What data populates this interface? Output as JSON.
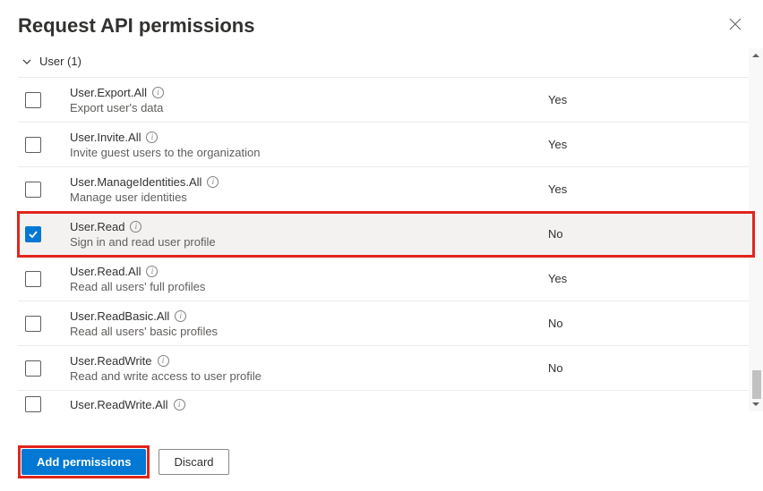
{
  "header": {
    "title": "Request API permissions"
  },
  "group": {
    "label": "User (1)"
  },
  "columns": {
    "admin_consent_yes": "Yes",
    "admin_consent_no": "No"
  },
  "permissions": [
    {
      "name": "User.Export.All",
      "description": "Export user's data",
      "admin": "Yes",
      "checked": false,
      "highlighted": false
    },
    {
      "name": "User.Invite.All",
      "description": "Invite guest users to the organization",
      "admin": "Yes",
      "checked": false,
      "highlighted": false
    },
    {
      "name": "User.ManageIdentities.All",
      "description": "Manage user identities",
      "admin": "Yes",
      "checked": false,
      "highlighted": false
    },
    {
      "name": "User.Read",
      "description": "Sign in and read user profile",
      "admin": "No",
      "checked": true,
      "highlighted": true
    },
    {
      "name": "User.Read.All",
      "description": "Read all users' full profiles",
      "admin": "Yes",
      "checked": false,
      "highlighted": false
    },
    {
      "name": "User.ReadBasic.All",
      "description": "Read all users' basic profiles",
      "admin": "No",
      "checked": false,
      "highlighted": false
    },
    {
      "name": "User.ReadWrite",
      "description": "Read and write access to user profile",
      "admin": "No",
      "checked": false,
      "highlighted": false
    }
  ],
  "cutoff_permission": {
    "name": "User.ReadWrite.All"
  },
  "footer": {
    "primary_label": "Add permissions",
    "secondary_label": "Discard"
  }
}
